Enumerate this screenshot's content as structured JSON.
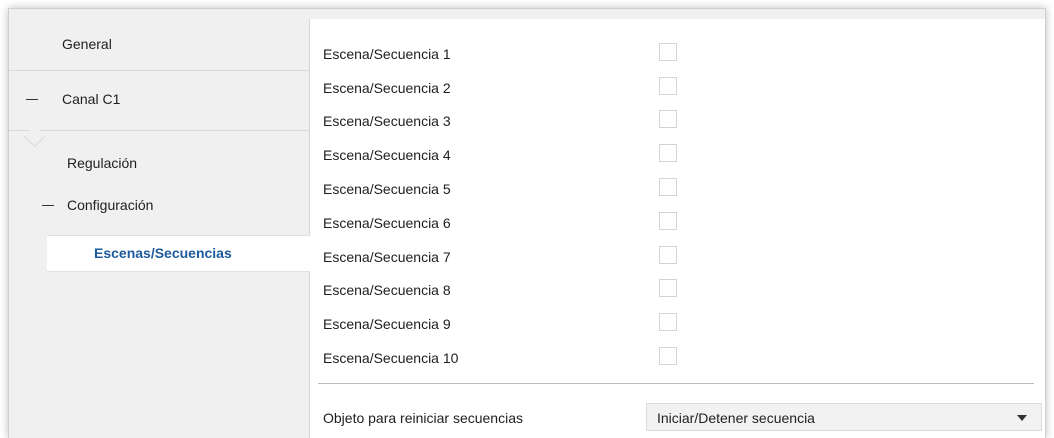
{
  "sidebar": {
    "items": [
      {
        "label": "General"
      },
      {
        "label": "Canal C1"
      },
      {
        "label": "Regulación"
      },
      {
        "label": "Configuración"
      },
      {
        "label": "Escenas/Secuencias"
      }
    ]
  },
  "main": {
    "rows": [
      {
        "label": "Escena/Secuencia 1",
        "checked": false
      },
      {
        "label": "Escena/Secuencia 2",
        "checked": false
      },
      {
        "label": "Escena/Secuencia 3",
        "checked": false
      },
      {
        "label": "Escena/Secuencia 4",
        "checked": false
      },
      {
        "label": "Escena/Secuencia 5",
        "checked": false
      },
      {
        "label": "Escena/Secuencia 6",
        "checked": false
      },
      {
        "label": "Escena/Secuencia 7",
        "checked": false
      },
      {
        "label": "Escena/Secuencia 8",
        "checked": false
      },
      {
        "label": "Escena/Secuencia 9",
        "checked": false
      },
      {
        "label": "Escena/Secuencia 10",
        "checked": false
      }
    ],
    "reset_object": {
      "label": "Objeto para reiniciar secuencias",
      "selected": "Iniciar/Detener secuencia"
    }
  },
  "colors": {
    "sidebar_bg": "#f0f0f0",
    "active_text": "#1d5b9c"
  }
}
